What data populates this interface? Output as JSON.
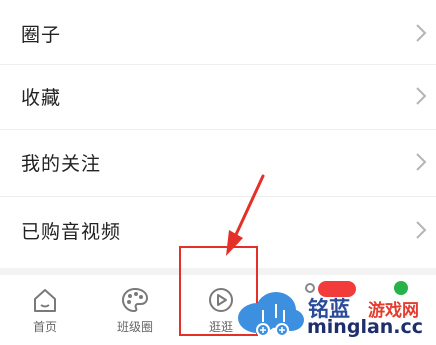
{
  "menu": {
    "items": [
      {
        "label": "圈子"
      },
      {
        "label": "收藏"
      },
      {
        "label": "我的关注"
      },
      {
        "label": "已购音视频"
      }
    ]
  },
  "tabbar": {
    "tabs": [
      {
        "label": "首页",
        "icon": "home-icon"
      },
      {
        "label": "班级圈",
        "icon": "palette-icon"
      },
      {
        "label": "逛逛",
        "icon": "play-icon"
      }
    ]
  },
  "annotation": {
    "color": "#e5302a"
  },
  "watermark": {
    "cn_brand": "铭蓝",
    "cn_suffix": "游戏网",
    "domain": "minglan.cc",
    "icon": "cloud-logo"
  }
}
